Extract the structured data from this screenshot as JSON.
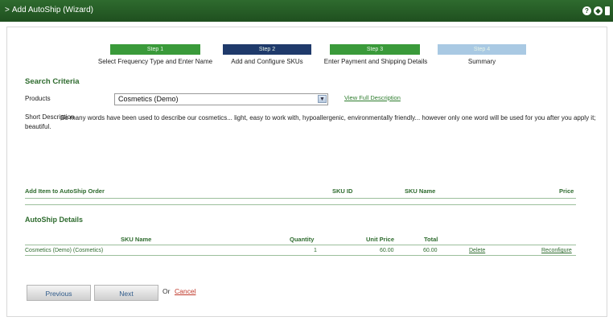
{
  "window": {
    "title": "Add AutoShip (Wizard)",
    "icons": [
      "help-icon",
      "settings-icon",
      "minimize-icon"
    ]
  },
  "steps": [
    {
      "tab": "Step 1",
      "label": "Select Frequency Type and Enter Name",
      "state": "complete",
      "color": "#3a9a3a"
    },
    {
      "tab": "Step 2",
      "label": "Add and Configure SKUs",
      "state": "current",
      "color": "#1f3a6b"
    },
    {
      "tab": "Step 3",
      "label": "Enter Payment and Shipping Details",
      "state": "pending",
      "color": "#3a9a3a"
    },
    {
      "tab": "Step 4",
      "label": "Summary",
      "state": "disabled",
      "color": "#a9c9e3"
    }
  ],
  "search": {
    "title": "Search Criteria",
    "products_label": "Products",
    "products_value": "Cosmetics (Demo)",
    "view_link": "View Full Description",
    "short_desc_label": "Short Description",
    "short_desc_text": "So many words have been used to describe our cosmetics... light, easy to work with, hypoallergenic, environmentally friendly... however only one word will be used for you after you apply it; beautiful."
  },
  "add_item": {
    "col_add": "Add Item to AutoShip Order",
    "col_sku_id": "SKU ID",
    "col_sku_name": "SKU Name",
    "col_price": "Price"
  },
  "details": {
    "title": "AutoShip Details",
    "headers": {
      "sku_name": "SKU Name",
      "quantity": "Quantity",
      "unit_price": "Unit Price",
      "total": "Total"
    },
    "rows": [
      {
        "sku_name": "Cosmetics (Demo) (Cosmetics)",
        "quantity": "1",
        "unit_price": "60.00",
        "total": "60.00",
        "delete": "Delete",
        "reconfigure": "Reconfigure"
      }
    ]
  },
  "actions": {
    "previous": "Previous",
    "next": "Next",
    "or": "Or",
    "cancel": "Cancel"
  }
}
